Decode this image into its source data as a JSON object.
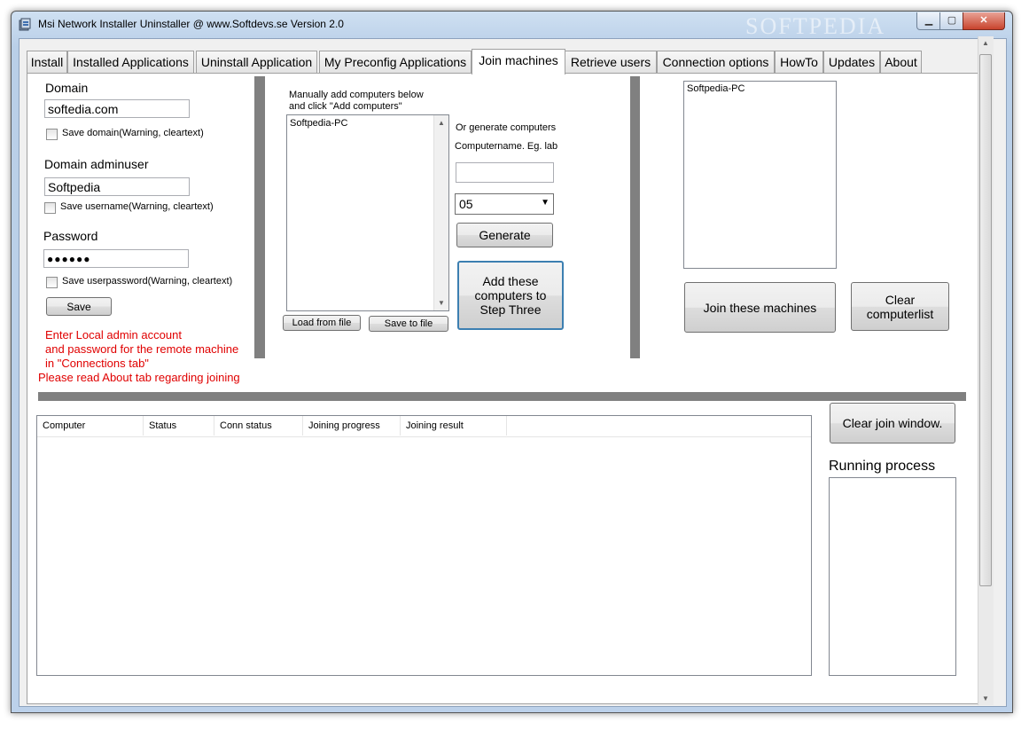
{
  "window": {
    "title": "Msi Network Installer Uninstaller @ www.Softdevs.se  Version 2.0",
    "min_label": "▁",
    "max_label": "▢",
    "close_label": "✕",
    "watermark": "SOFTPEDIA"
  },
  "tabs": [
    {
      "label": "Install"
    },
    {
      "label": "Installed Applications"
    },
    {
      "label": "Uninstall Application"
    },
    {
      "label": "My Preconfig Applications"
    },
    {
      "label": "Join machines"
    },
    {
      "label": "Retrieve users"
    },
    {
      "label": "Connection options"
    },
    {
      "label": "HowTo"
    },
    {
      "label": "Updates"
    },
    {
      "label": "About"
    }
  ],
  "credentials": {
    "domain_label": "Domain",
    "domain_value": "softedia.com",
    "save_domain_label": "Save domain(Warning, cleartext)",
    "adminuser_label": "Domain adminuser",
    "adminuser_value": "Softpedia",
    "save_username_label": "Save username(Warning, cleartext)",
    "password_label": "Password",
    "password_value": "●●●●●●",
    "save_password_label": "Save userpassword(Warning, cleartext)",
    "save_button": "Save",
    "note_line1": "Enter Local admin account",
    "note_line2": "and password for the remote machine",
    "note_line3": "in \"Connections tab\"",
    "note_line4": "Please read About tab regarding joining"
  },
  "manual": {
    "instruction_line1": "Manually add computers below",
    "instruction_line2": "and click \"Add computers\"",
    "computers": [
      "Softpedia-PC"
    ],
    "load_button": "Load from file",
    "save_button": "Save to file"
  },
  "generate": {
    "label_line1": "Or generate computers",
    "label_line2": "Computername. Eg. lab",
    "name_value": "",
    "count_value": "05",
    "generate_button": "Generate",
    "add_button_line1": "Add these",
    "add_button_line2": "computers to",
    "add_button_line3": "Step Three"
  },
  "target": {
    "computers": [
      "Softpedia-PC"
    ],
    "join_button": "Join these machines",
    "clear_button_line1": "Clear",
    "clear_button_line2": "computerlist"
  },
  "results": {
    "columns": [
      "Computer",
      "Status",
      "Conn status",
      "Joining progress",
      "Joining result"
    ],
    "clear_button": "Clear join window.",
    "running_label": "Running process"
  }
}
